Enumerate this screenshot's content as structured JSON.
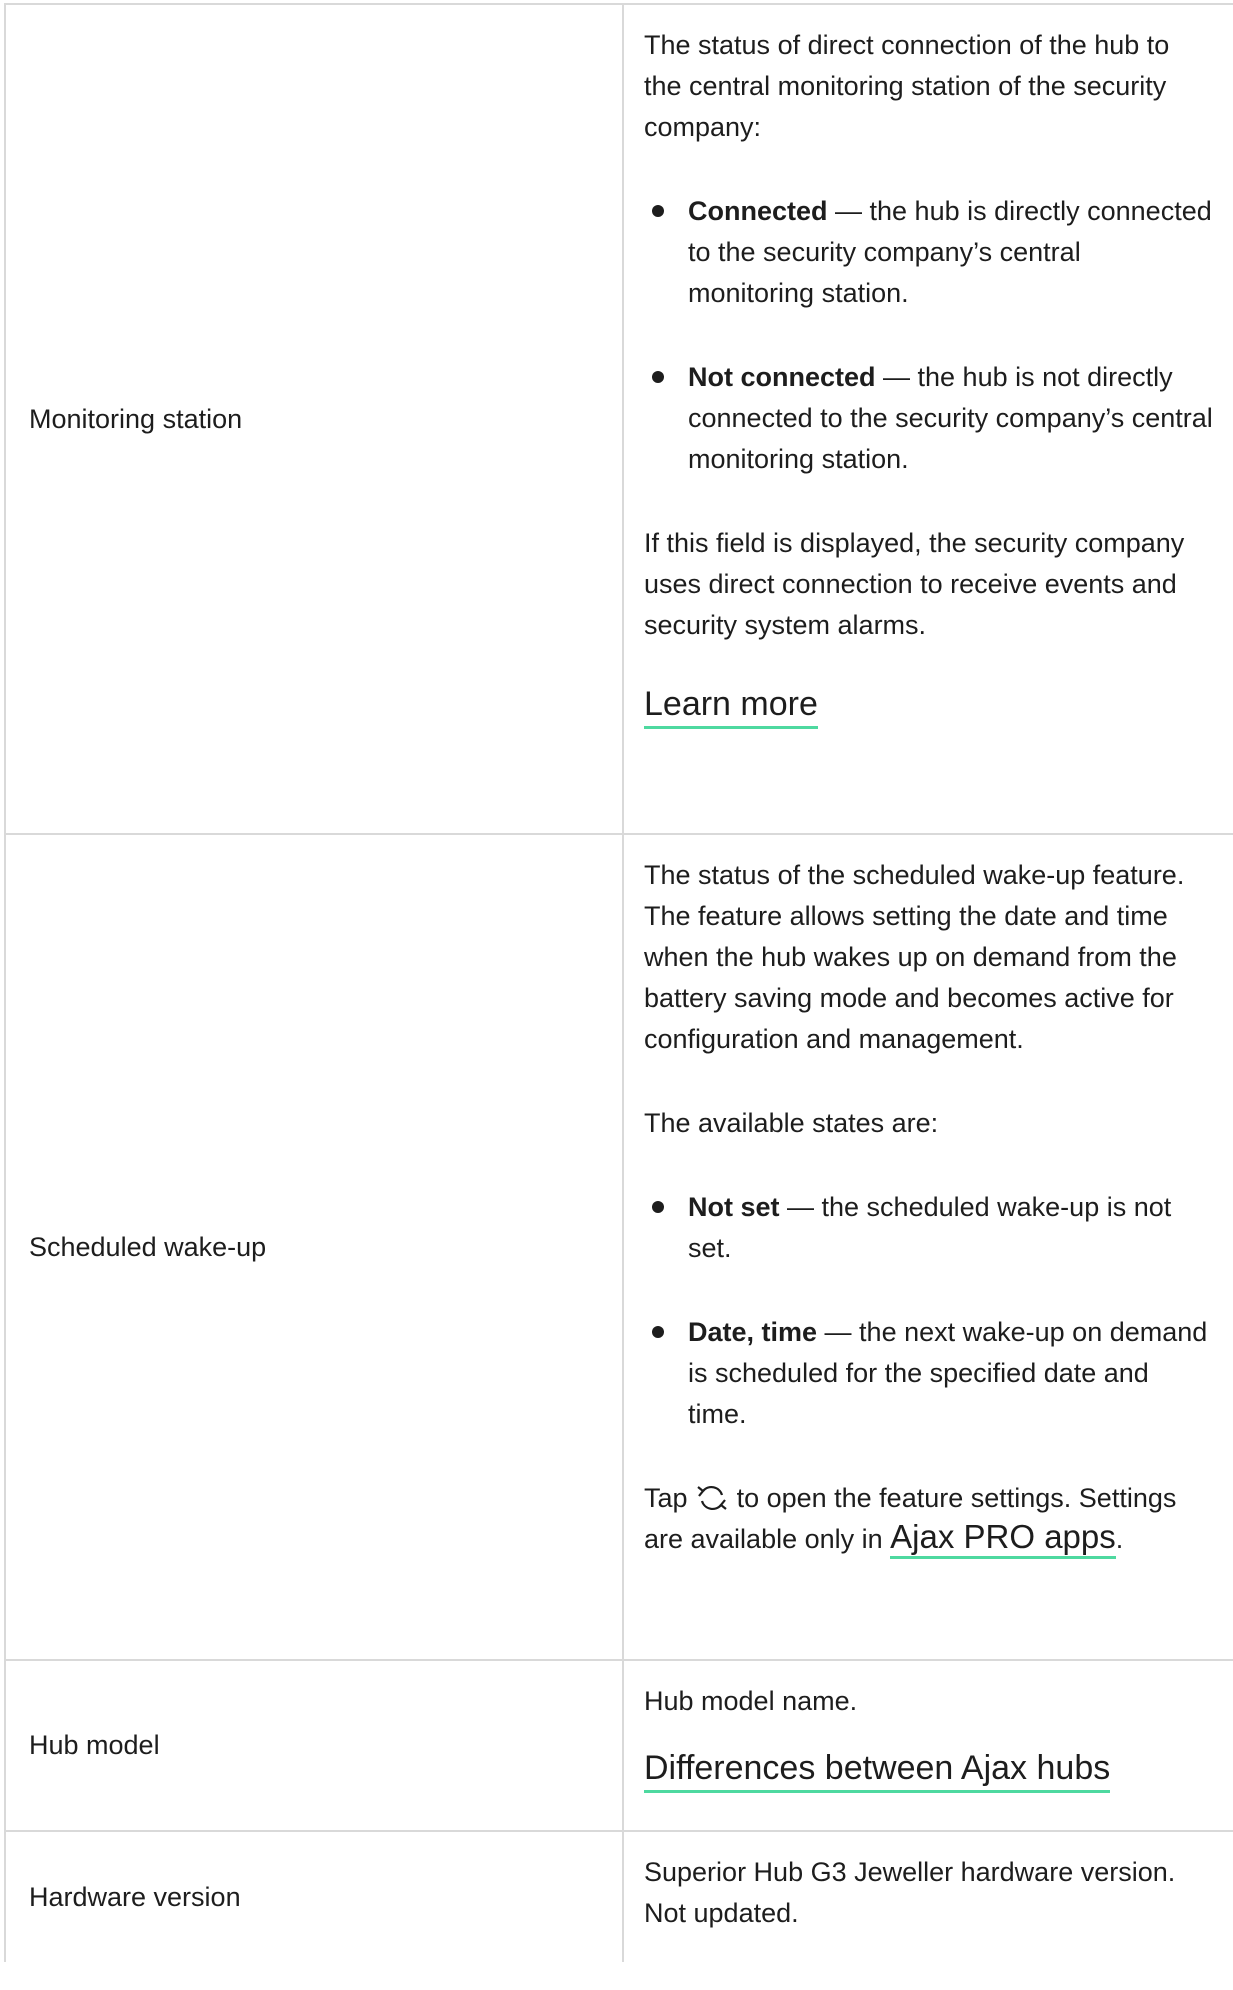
{
  "rows": [
    {
      "label": "Monitoring station",
      "intro": "The status of direct connection of the hub to the central monitoring station of the security company:",
      "bullets": [
        {
          "term": "Connected",
          "text": " — the hub is directly connected to the security company’s central monitoring station."
        },
        {
          "term": "Not connected",
          "text": " — the hub is not directly connected to the security company’s central monitoring station."
        }
      ],
      "outro": "If this field is displayed, the security company uses direct connection to receive events and security system alarms.",
      "link": "Learn more"
    },
    {
      "label": "Scheduled wake-up",
      "intro": "The status of the scheduled wake-up feature. The feature allows setting the date and time when the hub wakes up on demand from the battery saving mode and becomes active for configuration and management.",
      "states_intro": "The available states are:",
      "bullets": [
        {
          "term": "Not set",
          "text": " — the scheduled wake-up is not set."
        },
        {
          "term": "Date, time",
          "text": " — the next wake-up on demand is scheduled for the specified date and time."
        }
      ],
      "tap_prefix": "Tap",
      "tap_icon": "refresh-icon",
      "tap_suffix": " to open the feature settings. Settings are available only in ",
      "link": "Ajax PRO apps",
      "tail": "."
    },
    {
      "label": "Hub model",
      "intro": "Hub model name.",
      "link": "Differences between Ajax hubs"
    },
    {
      "label": "Hardware version",
      "intro": "Superior Hub G3 Jeweller hardware version. Not updated."
    }
  ],
  "colors": {
    "link_underline": "#4ed9a0",
    "border": "#d9d9d9",
    "text": "#1d1d1d"
  }
}
